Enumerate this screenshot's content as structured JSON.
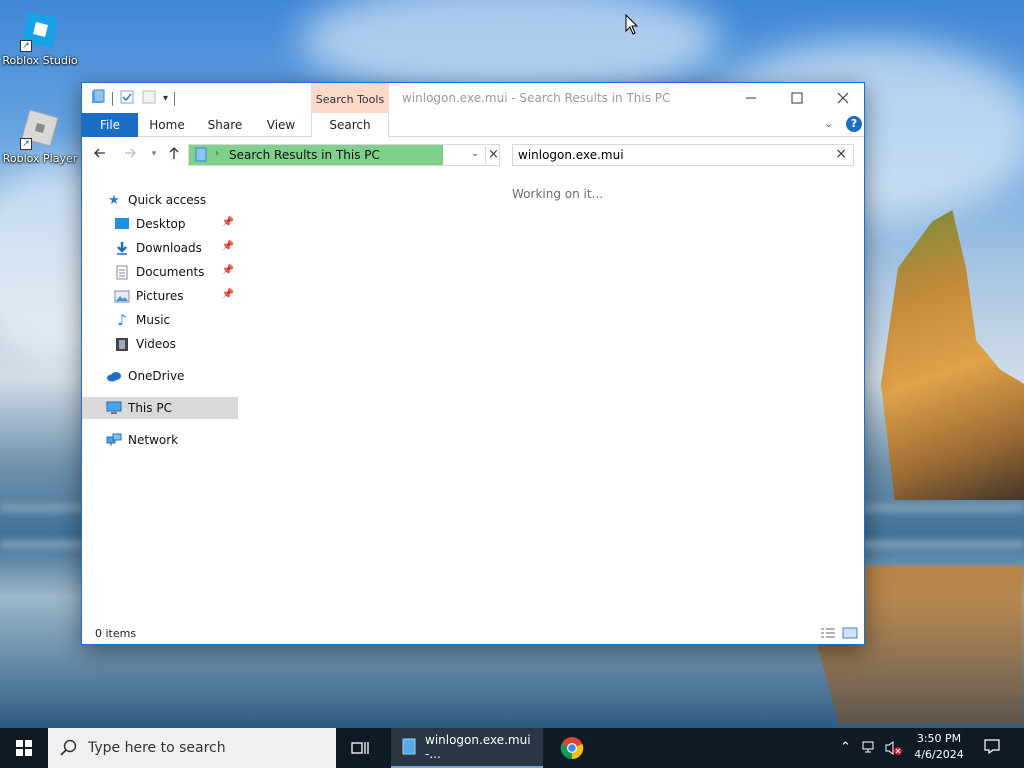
{
  "desktop": {
    "icons": [
      {
        "label": "Roblox Studio",
        "icon": "roblox-studio-icon"
      },
      {
        "label": "Roblox Player",
        "icon": "roblox-player-icon"
      }
    ]
  },
  "window": {
    "title": "winlogon.exe.mui - Search Results in This PC",
    "contextual_tab_header": "Search Tools",
    "ribbon_tabs": [
      "File",
      "Home",
      "Share",
      "View",
      "Search"
    ],
    "address_path": "Search Results in This PC",
    "search_value": "winlogon.exe.mui",
    "status_message": "Working on it...",
    "status_bar": "0 items",
    "nav": {
      "quick_access": "Quick access",
      "quick_items": [
        "Desktop",
        "Downloads",
        "Documents",
        "Pictures",
        "Music",
        "Videos"
      ],
      "onedrive": "OneDrive",
      "this_pc": "This PC",
      "network": "Network"
    },
    "colors": {
      "accent": "#1a6fc4",
      "search_tools_tab": "#fbd9c8",
      "address_progress": "#7fd08a"
    }
  },
  "taskbar": {
    "search_placeholder": "Type here to search",
    "explorer_label": "winlogon.exe.mui -...",
    "clock_time": "3:50 PM",
    "clock_date": "4/6/2024"
  }
}
